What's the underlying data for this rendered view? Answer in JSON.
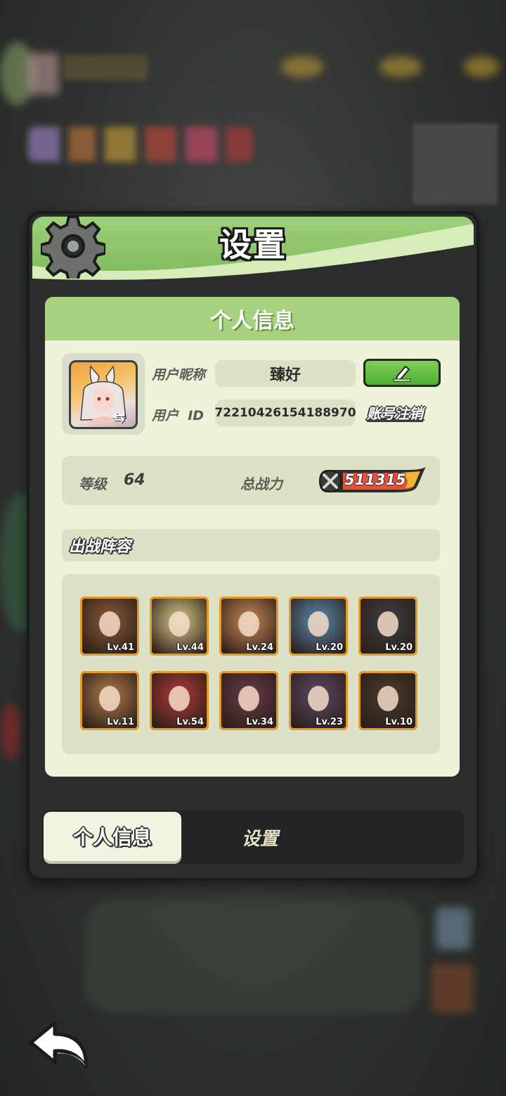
{
  "window": {
    "title": "设置"
  },
  "content": {
    "section_title": "个人信息"
  },
  "profile": {
    "nickname_label": "用户昵称",
    "nickname": "臻好",
    "id_label": "用户  ID",
    "user_id": "72210426154188970",
    "deregister_label": "账号注销"
  },
  "stats": {
    "level_label": "等级",
    "level": "64",
    "power_label": "总战力",
    "power": "511315"
  },
  "team": {
    "title": "出战阵容",
    "heroes": [
      {
        "level": "Lv.41",
        "color": "#8a5a3a"
      },
      {
        "level": "Lv.44",
        "color": "#d8c98a"
      },
      {
        "level": "Lv.24",
        "color": "#c98a5a"
      },
      {
        "level": "Lv.20",
        "color": "#5a8ab0"
      },
      {
        "level": "Lv.20",
        "color": "#3c3f44"
      },
      {
        "level": "Lv.11",
        "color": "#b07a4a"
      },
      {
        "level": "Lv.54",
        "color": "#b03a3a"
      },
      {
        "level": "Lv.34",
        "color": "#6a3a4a"
      },
      {
        "level": "Lv.23",
        "color": "#5a4a6a"
      },
      {
        "level": "Lv.10",
        "color": "#4a3a30"
      }
    ]
  },
  "tabs": {
    "active": "个人信息",
    "inactive": "设置"
  },
  "colors": {
    "accent_green": "#7fb95c",
    "panel_bg": "#eef2d9",
    "hero_frame": "#e39a2a"
  }
}
